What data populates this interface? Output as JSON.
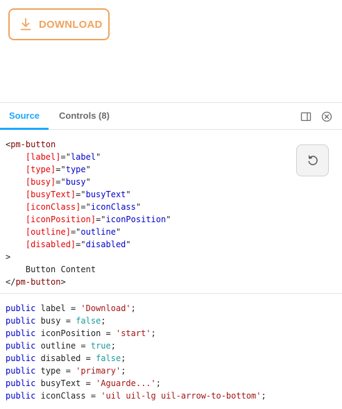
{
  "preview": {
    "button_label": "DOWNLOAD",
    "accent_color": "#f0a35c",
    "icon": "download-arrow-icon"
  },
  "tabs": {
    "source_label": "Source",
    "controls_label": "Controls (8)",
    "active": "Source",
    "active_color": "#1ea7fd"
  },
  "toolbar": {
    "panel_icon": "panel-toggle-icon",
    "close_icon": "close-circle-icon"
  },
  "source_code": {
    "open_bracket": "<",
    "component": "pm-button",
    "bindings": [
      {
        "attr": "[label]",
        "value": "label"
      },
      {
        "attr": "[type]",
        "value": "type"
      },
      {
        "attr": "[busy]",
        "value": "busy"
      },
      {
        "attr": "[busyText]",
        "value": "busyText"
      },
      {
        "attr": "[iconClass]",
        "value": "iconClass"
      },
      {
        "attr": "[iconPosition]",
        "value": "iconPosition"
      },
      {
        "attr": "[outline]",
        "value": "outline"
      },
      {
        "attr": "[disabled]",
        "value": "disabled"
      }
    ],
    "close_of_open_tag": ">",
    "content": "Button Content",
    "close_tag_open": "</",
    "close_tag_close": ">",
    "reset_icon": "rotate-ccw-icon"
  },
  "properties": [
    {
      "keyword": "public",
      "name": "label",
      "value": "'Download'",
      "kind": "string"
    },
    {
      "keyword": "public",
      "name": "busy",
      "value": "false",
      "kind": "bool"
    },
    {
      "keyword": "public",
      "name": "iconPosition",
      "value": "'start'",
      "kind": "string"
    },
    {
      "keyword": "public",
      "name": "outline",
      "value": "true",
      "kind": "bool"
    },
    {
      "keyword": "public",
      "name": "disabled",
      "value": "false",
      "kind": "bool"
    },
    {
      "keyword": "public",
      "name": "type",
      "value": "'primary'",
      "kind": "string"
    },
    {
      "keyword": "public",
      "name": "busyText",
      "value": "'Aguarde...'",
      "kind": "string"
    },
    {
      "keyword": "public",
      "name": "iconClass",
      "value": "'uil uil-lg uil-arrow-to-bottom'",
      "kind": "string"
    }
  ]
}
